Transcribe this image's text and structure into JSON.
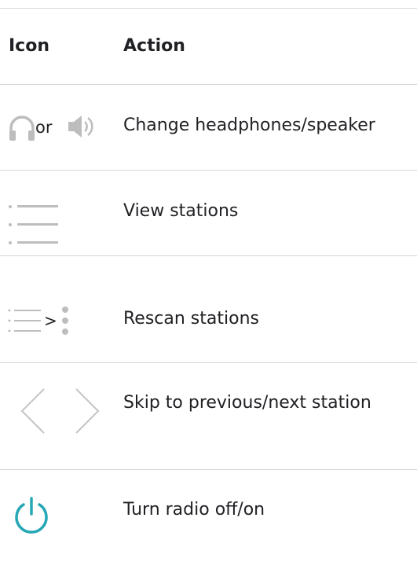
{
  "table": {
    "headers": {
      "icon": "Icon",
      "action": "Action"
    },
    "rows": [
      {
        "icons": [
          "headphones-icon",
          "speaker-icon"
        ],
        "connector": "or",
        "action": "Change headphones/speaker"
      },
      {
        "icons": [
          "list-icon"
        ],
        "action": "View stations"
      },
      {
        "icons": [
          "list-icon",
          "more-vert-icon"
        ],
        "connector": ">",
        "action": "Rescan stations"
      },
      {
        "icons": [
          "chevron-left-icon",
          "chevron-right-icon"
        ],
        "action": "Skip to previous/next station"
      },
      {
        "icons": [
          "power-icon"
        ],
        "action": "Turn radio off/on"
      }
    ]
  },
  "colors": {
    "divider": "#d6d6d6",
    "icon_gray": "#bdbdbd",
    "power_teal": "#26a7b5",
    "text": "#202124"
  }
}
